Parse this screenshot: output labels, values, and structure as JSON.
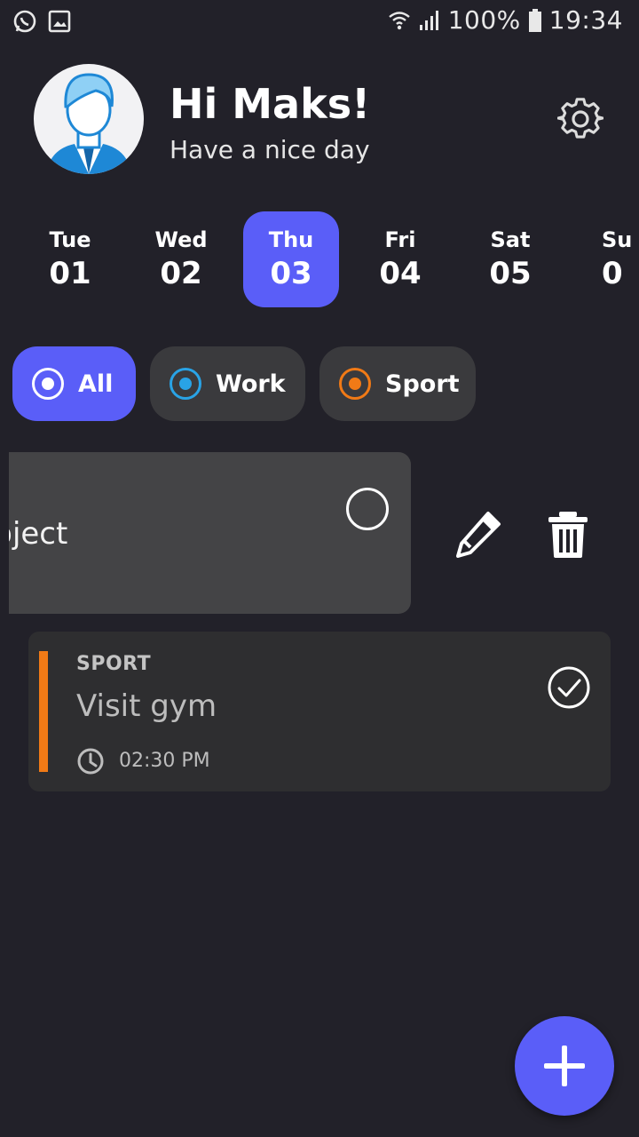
{
  "status_bar": {
    "battery": "100%",
    "time": "19:34",
    "icons": [
      "whatsapp-icon",
      "gallery-icon",
      "wifi-icon",
      "signal-icon",
      "battery-icon"
    ]
  },
  "header": {
    "greeting": "Hi Maks!",
    "subtitle": "Have a nice day",
    "settings_icon": "gear-icon"
  },
  "days": [
    {
      "name": "Tue",
      "num": "01",
      "active": false
    },
    {
      "name": "Wed",
      "num": "02",
      "active": false
    },
    {
      "name": "Thu",
      "num": "03",
      "active": true
    },
    {
      "name": "Fri",
      "num": "04",
      "active": false
    },
    {
      "name": "Sat",
      "num": "05",
      "active": false
    },
    {
      "name": "Su",
      "num": "0",
      "active": false
    }
  ],
  "filters": [
    {
      "label": "All",
      "color": "#ffffff",
      "active": true
    },
    {
      "label": "Work",
      "color": "#29a3e6",
      "active": false
    },
    {
      "label": "Sport",
      "color": "#f17a16",
      "active": false
    }
  ],
  "tasks": [
    {
      "title": "Project",
      "swiped": true,
      "actions": [
        "edit-icon",
        "trash-icon"
      ]
    },
    {
      "category": "SPORT",
      "title": "Visit gym",
      "time": "02:30 PM",
      "accent": "#f17a16",
      "done": true
    }
  ],
  "fab_icon": "plus-icon",
  "colors": {
    "accent": "#5a5ef8",
    "background": "#222129",
    "card": "#2e2e30"
  }
}
